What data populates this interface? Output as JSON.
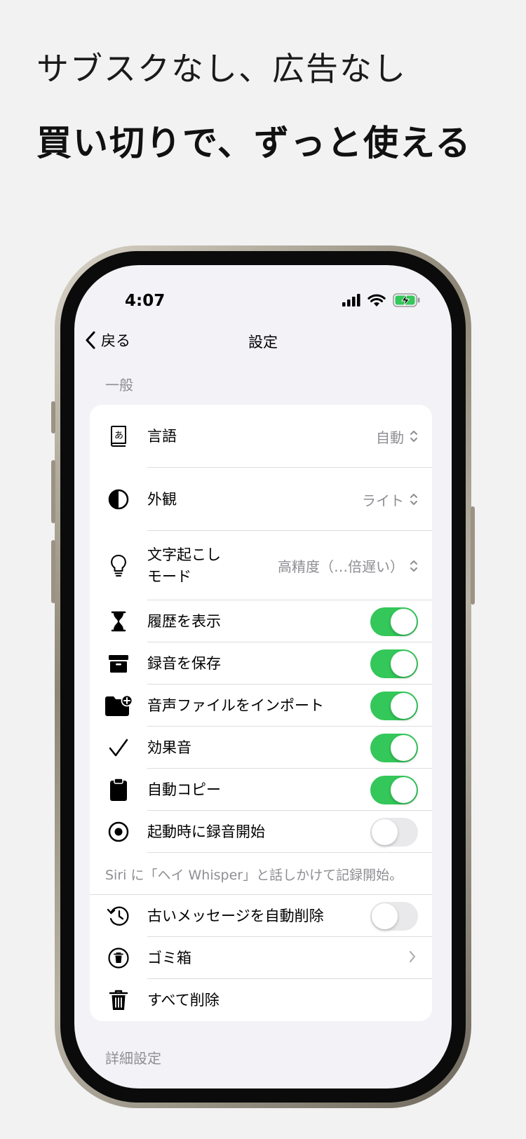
{
  "promo": {
    "line1": "サブスクなし、広告なし",
    "line2": "買い切りで、ずっと使える"
  },
  "status_bar": {
    "time": "4:07",
    "icons": [
      "cellular-signal-icon",
      "wifi-icon",
      "battery-charging-icon"
    ]
  },
  "nav": {
    "back_label": "戻る",
    "title": "設定"
  },
  "sections": {
    "general": "一般",
    "advanced": "詳細設定"
  },
  "general_rows": [
    {
      "label": "言語",
      "icon": "dictionary-icon",
      "value": "自動"
    },
    {
      "label": "外観",
      "icon": "contrast-icon",
      "value": "ライト"
    },
    {
      "label_line1": "文字起こし",
      "label_line2": "モード",
      "icon": "lightbulb-icon",
      "value": "高精度（…倍遅い）"
    },
    {
      "label": "履歴を表示",
      "icon": "hourglass-icon",
      "toggle": true
    },
    {
      "label": "録音を保存",
      "icon": "archive-box-icon",
      "toggle": true
    },
    {
      "label": "音声ファイルをインポート",
      "icon": "folder-add-icon",
      "toggle": true
    },
    {
      "label": "効果音",
      "icon": "checkmark-icon",
      "toggle": true
    },
    {
      "label": "自動コピー",
      "icon": "clipboard-icon",
      "toggle": true
    },
    {
      "label": "起動時に録音開始",
      "icon": "record-circle-icon",
      "toggle": false
    }
  ],
  "siri_hint": "Siri に「ヘイ Whisper」と話しかけて記録開始。",
  "cleanup_rows": [
    {
      "label": "古いメッセージを自動削除",
      "icon": "clock-arrow-icon",
      "toggle": false
    },
    {
      "label": "ゴミ箱",
      "icon": "trash-circle-icon"
    },
    {
      "label": "すべて削除",
      "icon": "trash-icon"
    }
  ],
  "colors": {
    "toggle_on": "#34c759",
    "toggle_off": "#e9e9eb",
    "background": "#f2f2f7",
    "secondary_text": "#8e8e93"
  }
}
